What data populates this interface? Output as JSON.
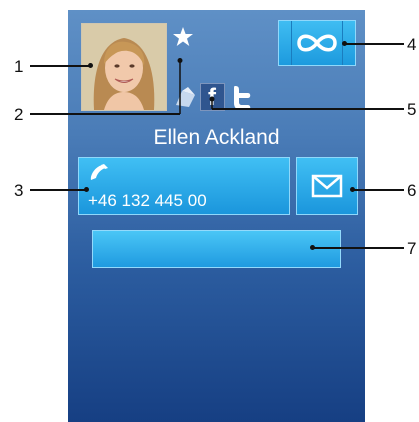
{
  "contact": {
    "name": "Ellen Ackland",
    "phone": "+46 132 445 00"
  },
  "callouts": [
    "1",
    "2",
    "3",
    "4",
    "5",
    "6",
    "7"
  ],
  "icons": {
    "favorite": "star-icon",
    "infinite": "infinity-icon",
    "chat": "chat-icon",
    "facebook": "facebook-icon",
    "twitter": "twitter-icon",
    "call": "phone-icon",
    "message": "envelope-icon"
  },
  "facebook_letter": "f",
  "colors": {
    "button_blue": "#1d9ade",
    "background_top": "#5f90c6",
    "background_bottom": "#163f83",
    "facebook": "#2f558f"
  }
}
